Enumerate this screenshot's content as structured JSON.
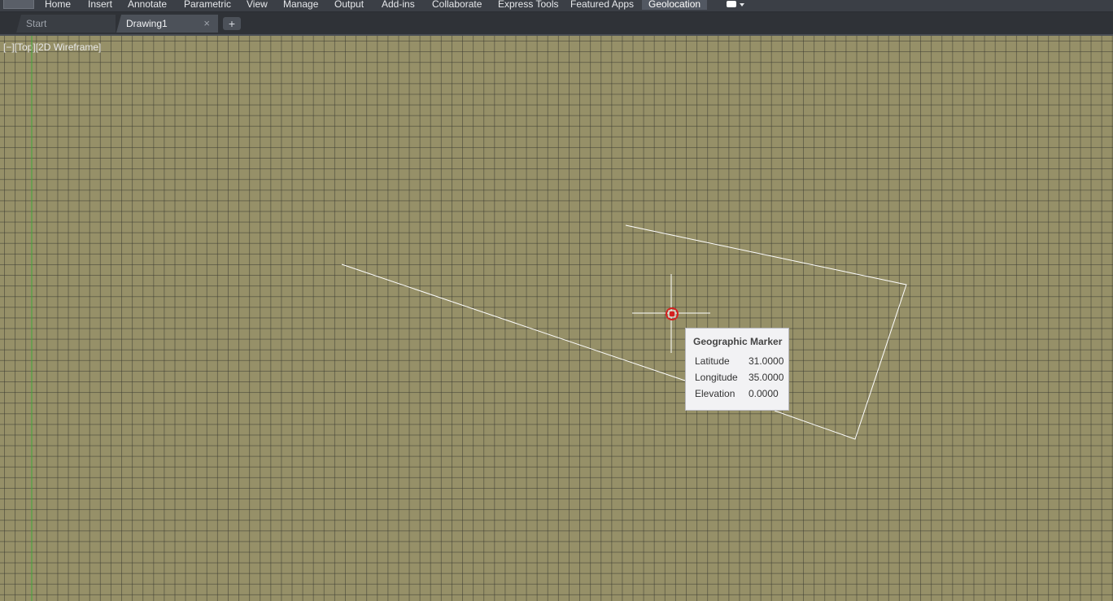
{
  "ribbon": {
    "tabs": [
      "Home",
      "Insert",
      "Annotate",
      "Parametric",
      "View",
      "Manage",
      "Output",
      "Add-ins",
      "Collaborate",
      "Express Tools",
      "Featured Apps",
      "Geolocation"
    ],
    "active_tab": "Geolocation"
  },
  "doc_tabs": {
    "start": "Start",
    "drawing": "Drawing1",
    "close_glyph": "×",
    "new_tab_glyph": "+"
  },
  "viewport": {
    "controls_label": "[−][Top][2D Wireframe]",
    "background_color": "#969068"
  },
  "marker_tooltip": {
    "title": "Geographic Marker",
    "rows": [
      {
        "label": "Latitude",
        "value": "31.0000"
      },
      {
        "label": "Longitude",
        "value": "35.0000"
      },
      {
        "label": "Elevation",
        "value": "0.0000"
      }
    ]
  },
  "colors": {
    "marker": "#d42020",
    "geometry": "#ffffff",
    "y_axis": "#3fa83a"
  }
}
